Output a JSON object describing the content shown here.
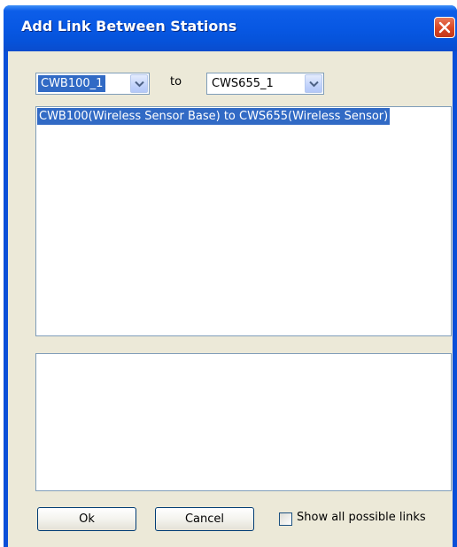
{
  "window": {
    "title": "Add Link Between Stations",
    "close_icon": "close-icon"
  },
  "selectors": {
    "from_value": "CWB100_1",
    "to_label": "to",
    "to_value": "CWS655_1"
  },
  "links_list": {
    "items": [
      "CWB100(Wireless Sensor Base) to CWS655(Wireless Sensor)"
    ]
  },
  "details_text": "",
  "buttons": {
    "ok_label": "Ok",
    "cancel_label": "Cancel"
  },
  "options": {
    "show_all_label": "Show all possible links",
    "show_all_checked": false
  },
  "colors": {
    "titlebar": "#0757e2",
    "selection": "#316ac5",
    "dialog_background": "#ece9d8",
    "close_button": "#d94622"
  }
}
